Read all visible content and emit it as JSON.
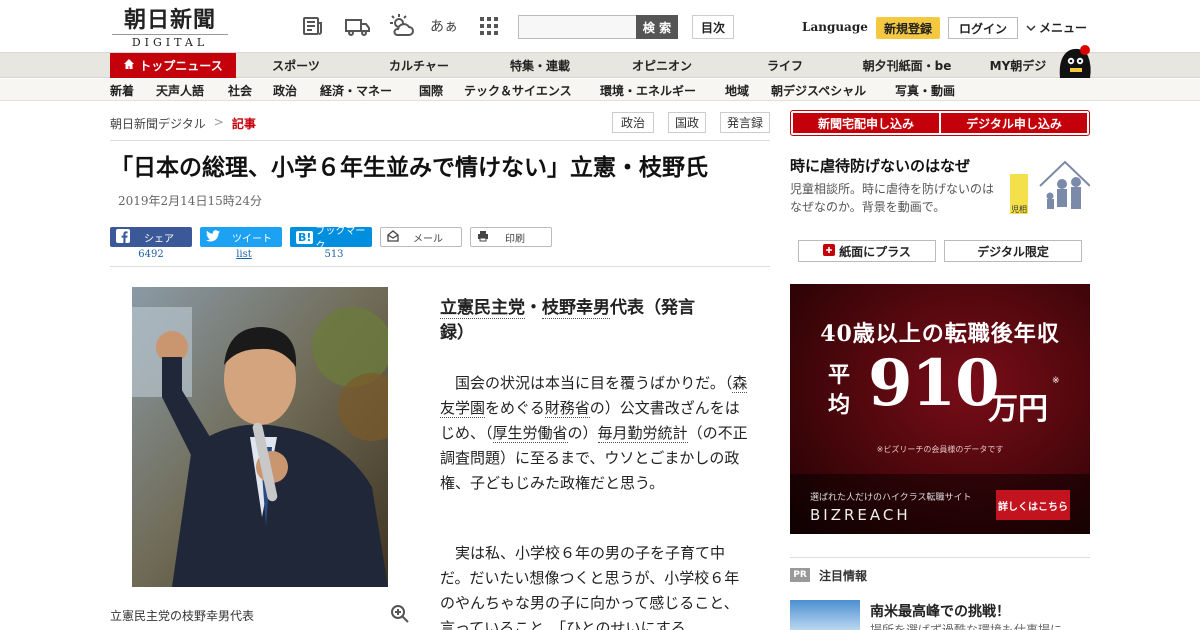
{
  "header": {
    "logo_ja": "朝日新聞",
    "logo_en": "DIGITAL",
    "font_size_label": "あぁ",
    "search_placeholder": "",
    "search_button": "検 索",
    "toc_button": "目次",
    "language": "Language",
    "register": "新規登録",
    "login": "ログイン",
    "menu": "メニュー"
  },
  "nav_primary": {
    "top": "トップニュース",
    "items": [
      "スポーツ",
      "カルチャー",
      "特集・連載",
      "オピニオン",
      "ライフ",
      "朝夕刊紙面・be",
      "MY朝デジ"
    ]
  },
  "nav_secondary": {
    "items": [
      "新着",
      "天声人語",
      "社会",
      "政治",
      "経済・マネー",
      "国際",
      "テック＆サイエンス",
      "環境・エネルギー",
      "地域",
      "朝デジスペシャル",
      "写真・動画"
    ]
  },
  "breadcrumb": {
    "home": "朝日新聞デジタル",
    "separator": ">",
    "current": "記事"
  },
  "tags": [
    "政治",
    "国政",
    "発言録"
  ],
  "article": {
    "headline": "「日本の総理、小学６年生並みで情けない」立憲・枝野氏",
    "date": "2019年2月14日15時24分",
    "lead_party": "立憲民主党",
    "lead_sep": "・",
    "lead_person": "枝野幸男",
    "lead_rest_1": "代表（発言",
    "lead_rest_2": "録）",
    "photo_caption": "立憲民主党の枝野幸男代表",
    "p1": {
      "t1": "国会の状況は本当に目を覆うばかりだ。（",
      "l1": "森友学園",
      "t2": "をめぐる",
      "l2": "財務省",
      "t3": "の）公文書改ざんをはじめ、（",
      "l3": "厚生労働省",
      "t4": "の）",
      "l4": "毎月勤労統計",
      "t5": "（の不正調査問題）に至るまで、ウソとごまかしの政権、子どもじみた政権だと思う。"
    },
    "p2": "実は私、小学校６年の男の子を子育て中だ。だいたい想像つくと思うが、小学校６年のやんちゃな男の子に向かって感じること、言っていること、「ひとのせいにする"
  },
  "share": {
    "facebook_label": "シェア",
    "facebook_count": "6492",
    "twitter_label": "ツイート",
    "twitter_count": "list",
    "hatena_label": "ブックマーク",
    "hatena_count": "513",
    "mail_label": "メール",
    "print_label": "印刷"
  },
  "sidebar": {
    "delivery_1": "新聞宅配申し込み",
    "delivery_2": "デジタル申し込み",
    "promo_title": "時に虐待防げないのはなぜ",
    "promo_desc": "児童相談所。時に虐待を防げないのはなぜなのか。背景を動画で。",
    "promo_img_text": "児相",
    "paper_plus": "紙面にプラス",
    "digital_only": "デジタル限定",
    "pr_badge": "PR",
    "pr_title": "注目情報",
    "pr_item_title": "南米最高峰での挑戦！",
    "pr_item_desc": "場所を選ばず過酷な環境も仕事場に"
  },
  "ad": {
    "line1": "40歳以上の転職後年収",
    "hei_1": "平",
    "hei_2": "均",
    "amount": "910",
    "unit": "万円",
    "star": "※",
    "note": "※ビズリーチの会員様のデータです",
    "tagline": "選ばれた人だけのハイクラス転職サイト",
    "brand": "BIZREACH",
    "cta": "詳しくはこちら"
  },
  "colors": {
    "brand_red": "#c4000a",
    "facebook": "#3b5998",
    "twitter": "#1da1f2",
    "hatena": "#008fde",
    "register_yellow": "#f5c842"
  }
}
